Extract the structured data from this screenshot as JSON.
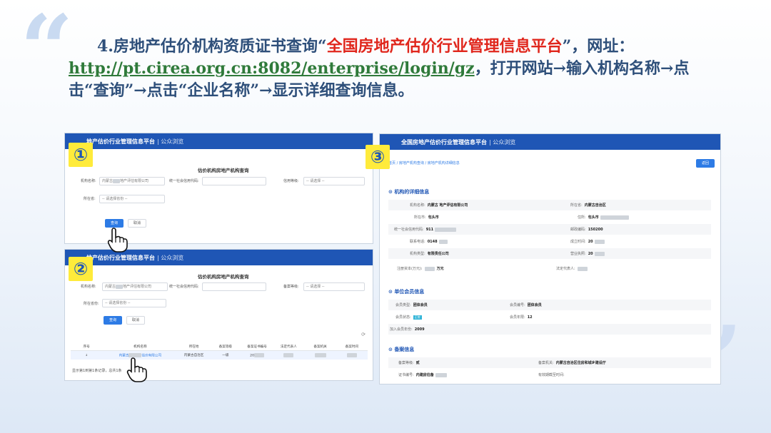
{
  "headline": {
    "part1": "4.房地产估价机构资质证书查询“",
    "platform": "全国房地产估价行业管理信息平台",
    "part2": "”，网址：",
    "url": "http://pt.cirea.org.cn:8082/enterprise/login/gz",
    "part3": "，打开网站→输入机构名称→点击“查询”→点击“企业名称”→显示详细查询信息。"
  },
  "screenshot1": {
    "badge": "①",
    "header": "地产估价行业管理信息平台",
    "header_sub": "| 公众浏览",
    "form_title": "估价机构房地产机构查询",
    "org_name_label": "机构名称:",
    "org_name_value_a": "内蒙古",
    "org_name_value_b": "地产评估有限公司",
    "credit_label": "统一社会信用代码:",
    "level_label": "信用等级:",
    "level_placeholder": "-- 请选择 --",
    "region_label": "所在省:",
    "region_placeholder": "-- 请选择省份 --",
    "query_button": "查询",
    "clear_button": "取消"
  },
  "screenshot2": {
    "badge": "②",
    "header": "地产估价行业管理信息平台",
    "header_sub": "| 公众浏览",
    "form_title": "估价机构房地产机构查询",
    "org_name_label": "机构名称:",
    "org_name_value_a": "内蒙古",
    "org_name_value_b": "地产评估有限公司",
    "credit_label": "统一社会信用代码:",
    "level_label": "备案等级:",
    "level_placeholder": "-- 请选择 --",
    "region_label": "所在省份:",
    "region_placeholder": "-- 请选择省份 --",
    "query_button": "查询",
    "clear_button": "取消",
    "table_headers": [
      "序号",
      "机构名称",
      "所在地",
      "备案等级",
      "备案证书编号",
      "法定代表人",
      "备案机关",
      "备案时间"
    ],
    "table_row": {
      "index": "1",
      "name": "内蒙古",
      "name_tail": "估价有限公司",
      "location": "内蒙古自治区",
      "level": "一级",
      "cert": "20",
      "rep": "",
      "org": "",
      "time": ""
    },
    "pager": "显示第1到第1条记录，总共1条"
  },
  "screenshot3": {
    "badge": "③",
    "header": "全国房地产估价行业管理信息平台",
    "header_sub": "| 公众浏览",
    "crumb": "首页 / 房地产机构查询 / 房地产机构详细信息",
    "back_button": "返回",
    "sec1": "机构的详细信息",
    "sec2": "单位会员信息",
    "sec3": "备案信息",
    "f_name_label": "机构名称:",
    "f_name_value": "内蒙古 地产评估有限公司",
    "f_region_label": "所在省:",
    "f_region_value": "内蒙古自治区",
    "f_city_label": "所在市:",
    "f_city_value": "包头市",
    "f_addr_label": "住所:",
    "f_addr_value": "包头市",
    "f_credit_label": "统一社会信用代码:",
    "f_credit_value": "911",
    "f_zip_label": "邮政编码:",
    "f_zip_value": "150200",
    "f_phone_label": "联系电话:",
    "f_phone_value": "0148",
    "f_found_label": "成立时间:",
    "f_found_value": "20",
    "f_type_label": "机构类型:",
    "f_type_value": "有限责任公司",
    "f_license_label": "营业执照:",
    "f_license_value": "20",
    "f_capital_label": "注册资本(万元):",
    "f_capital_value": "万元",
    "f_rep_label": "法定代表人:",
    "m_type_label": "会员类型:",
    "m_type_value": "团体会员",
    "m_no_label": "会员编号:",
    "m_no_value": "团体会员",
    "m_status_label": "会员状态:",
    "m_status_value": "正常",
    "m_years_label": "会员年限:",
    "m_years_value": "12",
    "m_join_label": "加入会员年份:",
    "m_join_value": "2009",
    "r_level_label": "备案等级:",
    "r_level_value": "贰",
    "r_org_label": "备案机关:",
    "r_org_value": "内蒙古自治区住房和城乡建设厅",
    "r_cert_label": "证书编号:",
    "r_cert_value": "内建房估备",
    "r_valid_label": "有效期截至时间:"
  }
}
